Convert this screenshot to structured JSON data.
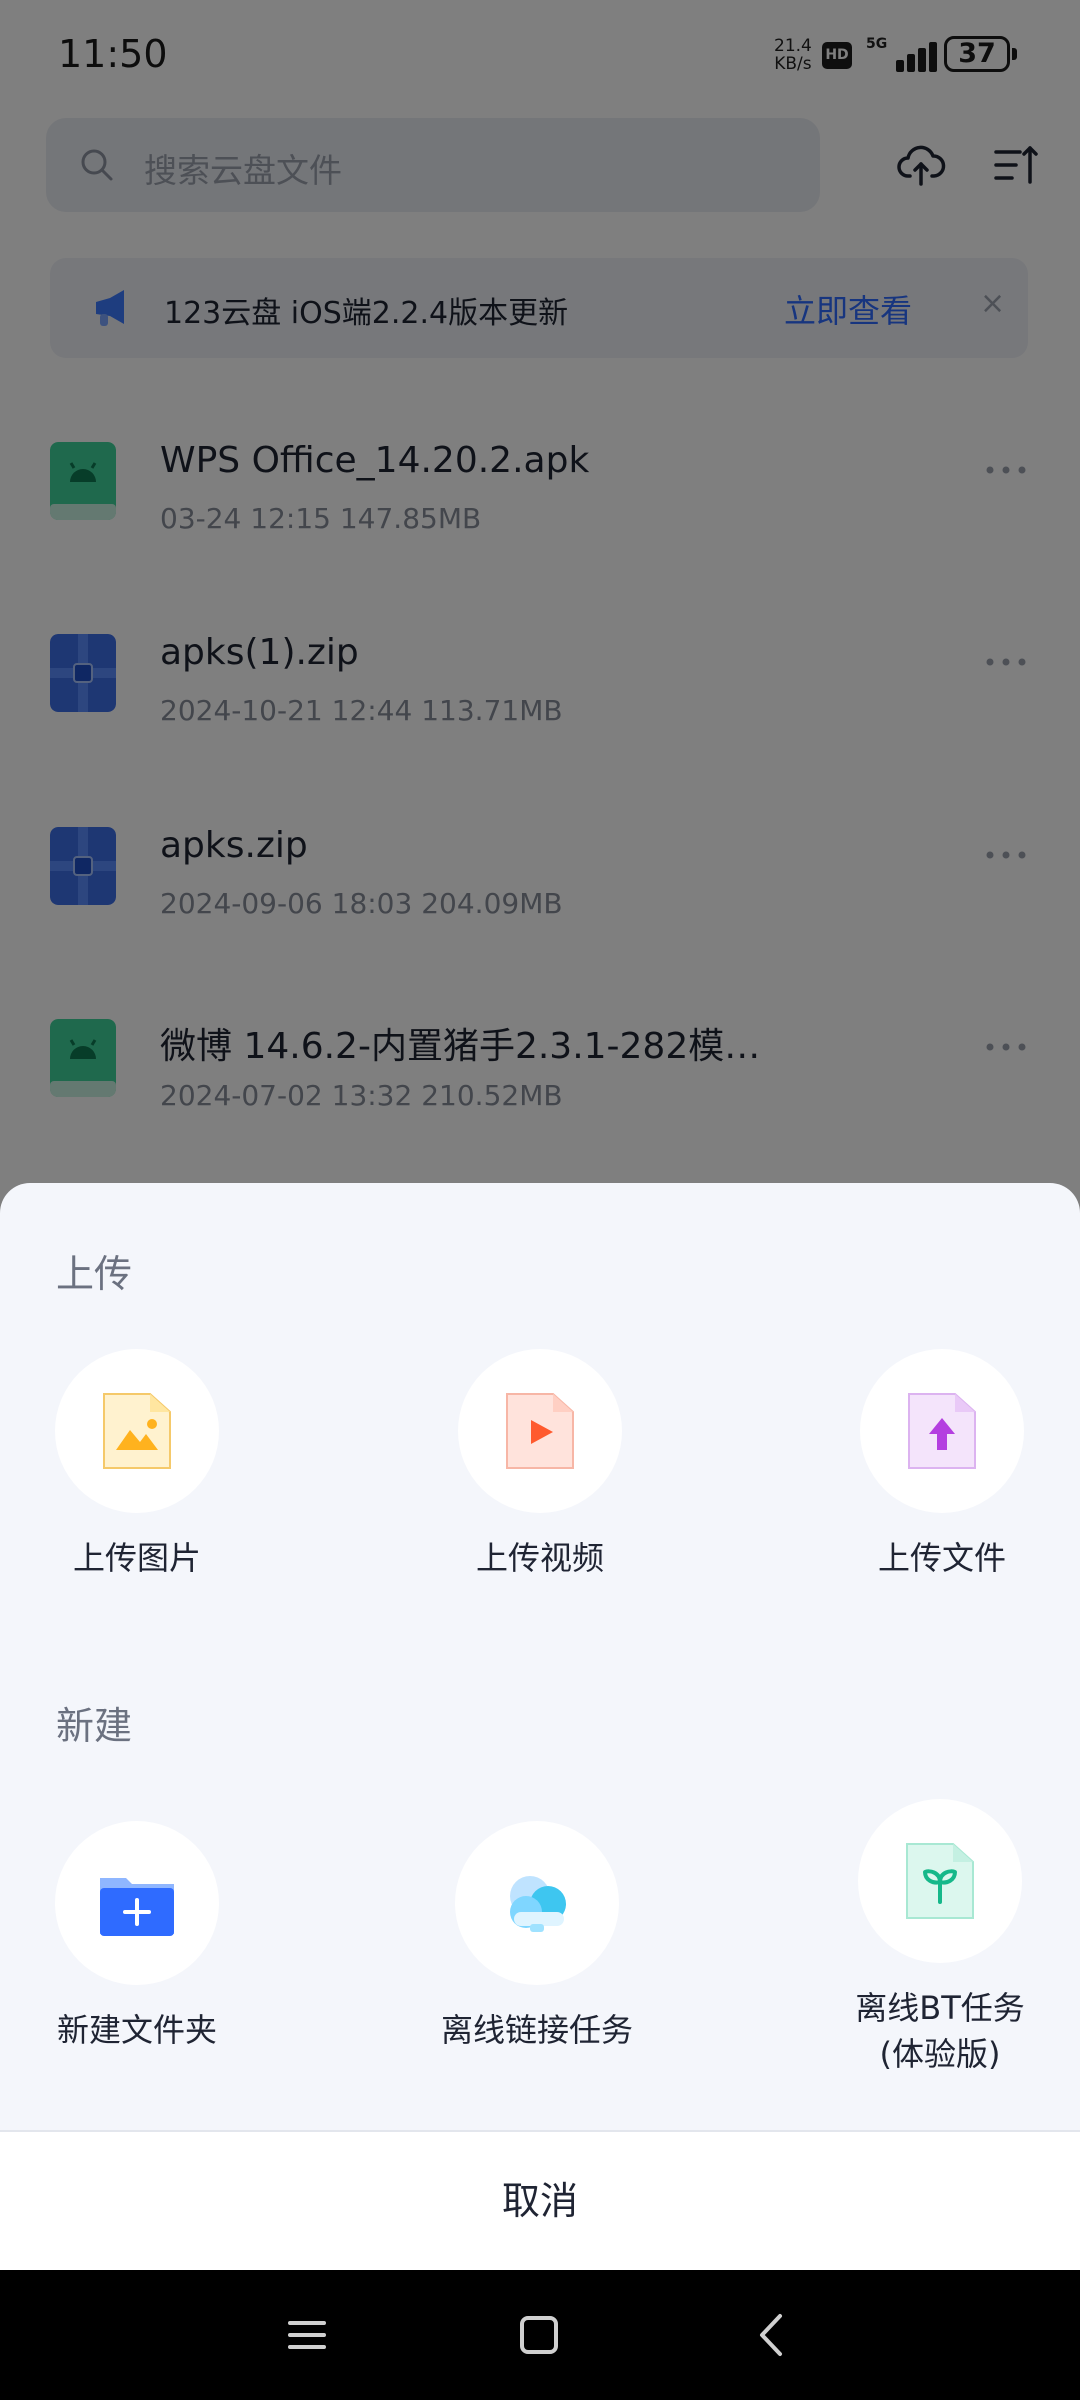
{
  "status_bar": {
    "time": "11:50",
    "net_speed_value": "21.4",
    "net_speed_unit": "KB/s",
    "hd_badge": "HD",
    "network_type": "5G",
    "battery_level": "37"
  },
  "search": {
    "placeholder": "搜索云盘文件",
    "icon": "search-icon"
  },
  "toolbar": {
    "upload_icon": "cloud-upload-icon",
    "sort_icon": "sort-icon"
  },
  "notice": {
    "icon": "megaphone-icon",
    "text": "123云盘 iOS端2.2.4版本更新",
    "link_label": "立即查看",
    "close_label": "×"
  },
  "files": [
    {
      "name": "WPS Office_14.20.2.apk",
      "date": "03-24 12:15",
      "size": "147.85MB",
      "icon": "android-apk-icon"
    },
    {
      "name": "apks(1).zip",
      "date": "2024-10-21 12:44",
      "size": "113.71MB",
      "icon": "zip-archive-icon"
    },
    {
      "name": "apks.zip",
      "date": "2024-09-06 18:03",
      "size": "204.09MB",
      "icon": "zip-archive-icon"
    },
    {
      "name": "微博 14.6.2-内置猪手2.3.1-282模…",
      "date": "2024-07-02 13:32",
      "size": "210.52MB",
      "icon": "android-apk-icon"
    }
  ],
  "sheet": {
    "upload_section_title": "上传",
    "upload_actions": [
      {
        "label": "上传图片",
        "icon": "image-file-icon"
      },
      {
        "label": "上传视频",
        "icon": "video-file-icon"
      },
      {
        "label": "上传文件",
        "icon": "upload-file-icon"
      }
    ],
    "create_section_title": "新建",
    "create_actions": [
      {
        "label": "新建文件夹",
        "icon": "new-folder-icon"
      },
      {
        "label": "离线链接任务",
        "icon": "offline-cloud-icon"
      },
      {
        "label_line1": "离线BT任务",
        "label_line2": "(体验版)",
        "icon": "bt-sprout-icon"
      }
    ],
    "cancel_label": "取消"
  },
  "colors": {
    "accent": "#2f6bff",
    "sheet_bg": "#f4f6fb",
    "overlay": "rgba(0,0,0,0.5)"
  }
}
